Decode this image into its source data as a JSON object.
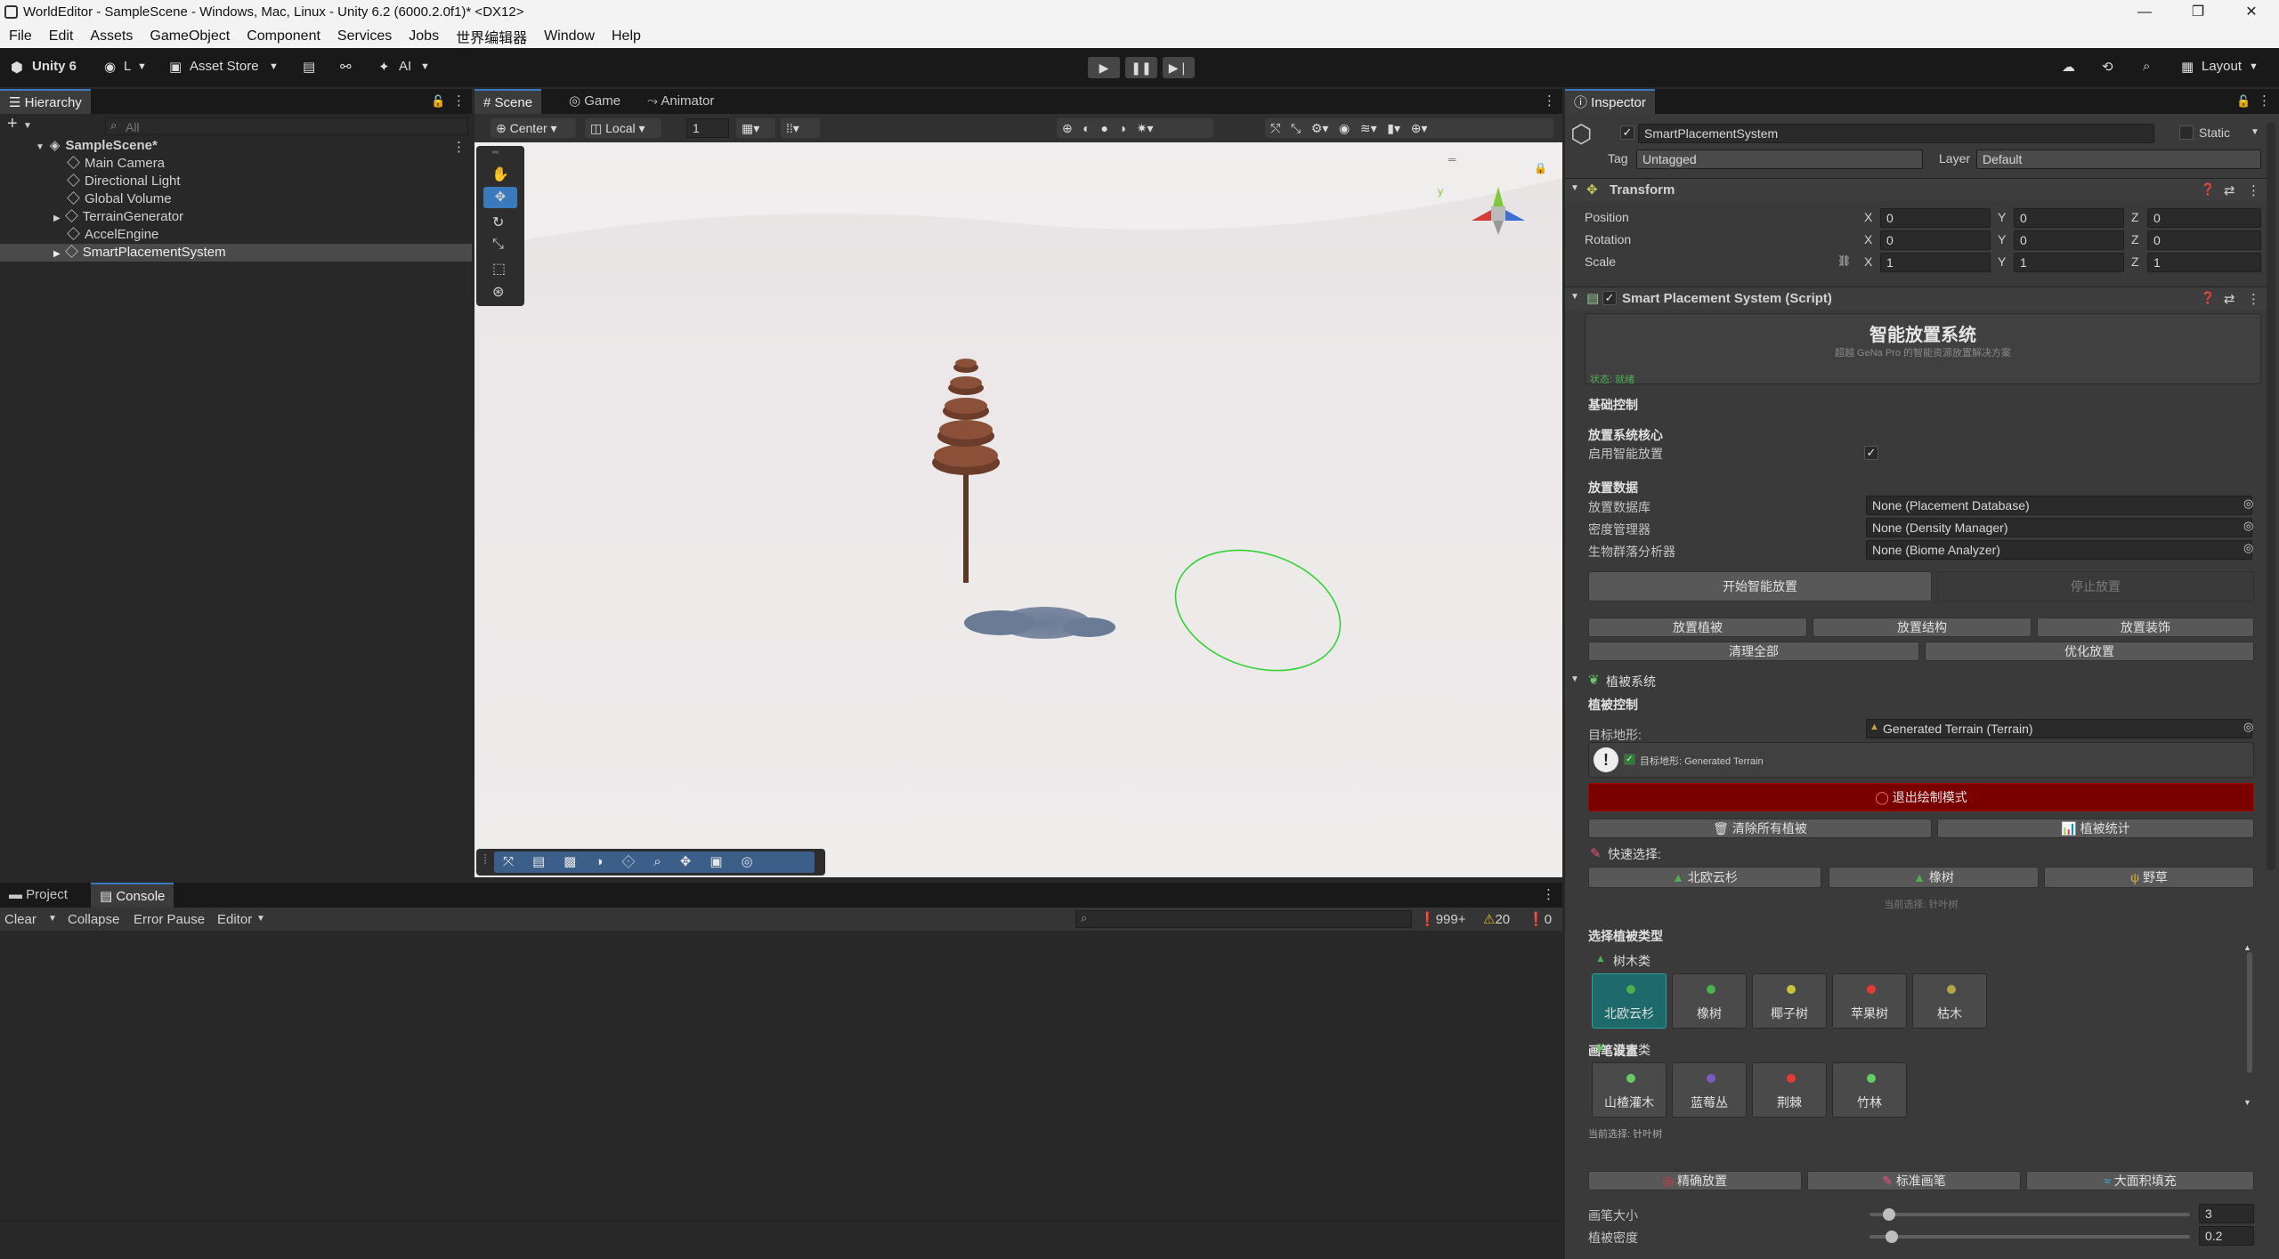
{
  "window": {
    "title": "WorldEditor - SampleScene - Windows, Mac, Linux - Unity 6.2 (6000.2.0f1)* <DX12>",
    "minimize": "—",
    "maximize": "❐",
    "close": "✕"
  },
  "menu": [
    "File",
    "Edit",
    "Assets",
    "GameObject",
    "Component",
    "Services",
    "Jobs",
    "世界编辑器",
    "Window",
    "Help"
  ],
  "toolbar": {
    "brand": "Unity 6",
    "account": "L",
    "asset_store": "Asset Store",
    "ai": "AI",
    "layout": "Layout"
  },
  "hierarchy": {
    "tab": "Hierarchy",
    "search_placeholder": "All",
    "scene": "SampleScene*",
    "items": [
      "Main Camera",
      "Directional Light",
      "Global Volume",
      "TerrainGenerator",
      "AccelEngine",
      "SmartPlacementSystem"
    ]
  },
  "scene_tabs": [
    "Scene",
    "Game",
    "Animator"
  ],
  "scene_toolbar": {
    "pivot": "Center",
    "space": "Local",
    "grid": "1"
  },
  "bottom": {
    "tabs": [
      "Project",
      "Console"
    ],
    "console": {
      "clear": "Clear",
      "collapse": "Collapse",
      "error_pause": "Error Pause",
      "editor": "Editor",
      "count_info": "999+",
      "count_warn": "20",
      "count_error": "0"
    }
  },
  "inspector": {
    "tab": "Inspector",
    "object_name": "SmartPlacementSystem",
    "static": "Static",
    "tag_label": "Tag",
    "tag": "Untagged",
    "layer_label": "Layer",
    "layer": "Default",
    "transform": {
      "title": "Transform",
      "position": "Position",
      "rotation": "Rotation",
      "scale": "Scale",
      "pos": [
        "0",
        "0",
        "0"
      ],
      "rot": [
        "0",
        "0",
        "0"
      ],
      "scl": [
        "1",
        "1",
        "1"
      ],
      "x": "X",
      "y": "Y",
      "z": "Z"
    },
    "script": {
      "title": "Smart Placement System (Script)",
      "header": "智能放置系统",
      "subheader": "超越 GeNa Pro 的智能资源放置解决方案",
      "status": "状态: 就绪",
      "basic": "基础控制",
      "core": "放置系统核心",
      "enable": "启用智能放置",
      "data": "放置数据",
      "db_label": "放置数据库",
      "db": "None (Placement Database)",
      "dens_label": "密度管理器",
      "dens": "None (Density Manager)",
      "biome_label": "生物群落分析器",
      "biome": "None (Biome Analyzer)",
      "start": "开始智能放置",
      "stop": "停止放置",
      "veg": "放置植被",
      "struct": "放置结构",
      "deco": "放置装饰",
      "clear": "清理全部",
      "optimize": "优化放置"
    },
    "veg": {
      "title": "植被系统",
      "control": "植被控制",
      "target_label": "目标地形:",
      "target": "Generated Terrain (Terrain)",
      "target_info": "目标地形: Generated Terrain",
      "exit_paint": "退出绘制模式",
      "clear_all": "清除所有植被",
      "stats": "植被统计",
      "quick": "快速选择:",
      "quick_items": [
        "北欧云杉",
        "橡树",
        "野草"
      ],
      "current_quick": "当前选择: 针叶树",
      "choose": "选择植被类型",
      "trees": "树木类",
      "tree_items": [
        "北欧云杉",
        "橡树",
        "椰子树",
        "苹果树",
        "枯木"
      ],
      "shrubs": "灌木类",
      "shrub_items": [
        "山楂灌木",
        "蓝莓丛",
        "荆棘",
        "竹林"
      ],
      "current": "当前选择: 针叶树",
      "brush": "画笔设置",
      "brush_modes": [
        "精确放置",
        "标准画笔",
        "大面积填充"
      ],
      "brush_size_label": "画笔大小",
      "brush_size": "3",
      "density_label": "植被密度",
      "density": "0.2",
      "brush_size_frac": 0.06,
      "density_frac": 0.07
    }
  },
  "colors": {
    "accent": "#3a79bb",
    "exit_paint": "#8a0000",
    "selected_tile": "#1e6a6a",
    "gizmo_circle": "#35d335"
  }
}
